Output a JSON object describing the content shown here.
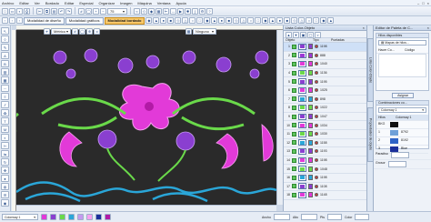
{
  "menu": [
    "Archivo",
    "Editar",
    "Ver",
    "Bordado",
    "Editar",
    "Especial",
    "Organizar",
    "Imagen",
    "Máquina",
    "Ventana",
    "Ayuda"
  ],
  "toolbar": {
    "zoom_value": "75",
    "modes": [
      "Modalidad de diseño",
      "Modalidad gráficos",
      "Modalidad bordado"
    ],
    "active_mode_index": 2
  },
  "canvas_toolbar": {
    "metric_label": "Métrico",
    "ninguno_label": "Ninguno"
  },
  "color_panel": {
    "title": "Lista Color-Objeto",
    "col_headers": [
      "Objeto",
      "Tipo",
      "Puntadas"
    ],
    "rows": [
      {
        "num": "1",
        "stitches": "1198"
      },
      {
        "num": "2",
        "stitches": "888"
      },
      {
        "num": "3",
        "stitches": "1040"
      },
      {
        "num": "4",
        "stitches": "1136"
      },
      {
        "num": "5",
        "stitches": "1195"
      },
      {
        "num": "6",
        "stitches": "1025"
      },
      {
        "num": "7",
        "stitches": "898"
      },
      {
        "num": "8",
        "stitches": "1022"
      },
      {
        "num": "9",
        "stitches": "1047"
      },
      {
        "num": "10",
        "stitches": "1034"
      },
      {
        "num": "11",
        "stitches": "1030"
      },
      {
        "num": "12",
        "stitches": "1158"
      },
      {
        "num": "13",
        "stitches": "1193"
      },
      {
        "num": "14",
        "stitches": "1198"
      },
      {
        "num": "15",
        "stitches": "1048"
      },
      {
        "num": "16",
        "stitches": "1198"
      },
      {
        "num": "17",
        "stitches": "1108"
      },
      {
        "num": "18",
        "stitches": "1148"
      }
    ],
    "swatch_colors": [
      "#8a3fd0",
      "#9c3ad6",
      "#e23ad8",
      "#6ad94a",
      "#8a3fd0",
      "#e23ad8",
      "#2aa6d8",
      "#6ad94a",
      "#8a3fd0",
      "#e23ad8",
      "#6ad94a",
      "#2aa6d8",
      "#8a3fd0",
      "#e23ad8",
      "#6ad94a",
      "#2aa6d8",
      "#8a3fd0",
      "#e23ad8"
    ]
  },
  "side_tabs": [
    "Lista Color-Objeto",
    "Propiedades de objeto"
  ],
  "palette_panel": {
    "title": "Editor de Paleta de C...",
    "available_threads_label": "Hilos disponibles",
    "threads_chart_label": "Mapas de hilos...",
    "search_cols": [
      "Hacer Co...",
      "Código"
    ],
    "assign_button": "Asignar",
    "combos_label": "Combinaciones co...",
    "combo_value": "Colorway 1",
    "hilos_header": [
      "Hilos",
      "Colorway 1"
    ],
    "hilo_rows": [
      {
        "code": "BKG",
        "name": ""
      },
      {
        "code": "1",
        "name": "8792"
      },
      {
        "code": "2",
        "name": "8192"
      },
      {
        "code": "3",
        "name": "Blue"
      }
    ],
    "hilo_colors": [
      "#111111",
      "#6ea0d8",
      "#2e63c6",
      "#1b2f9a"
    ],
    "paradiso_label": "Paradiso",
    "grosor_label": "Grosor"
  },
  "statusbar": {
    "colorway": "Colorway 1",
    "coords": [
      "Ancho",
      "Alto",
      "Pts",
      "Color"
    ]
  }
}
